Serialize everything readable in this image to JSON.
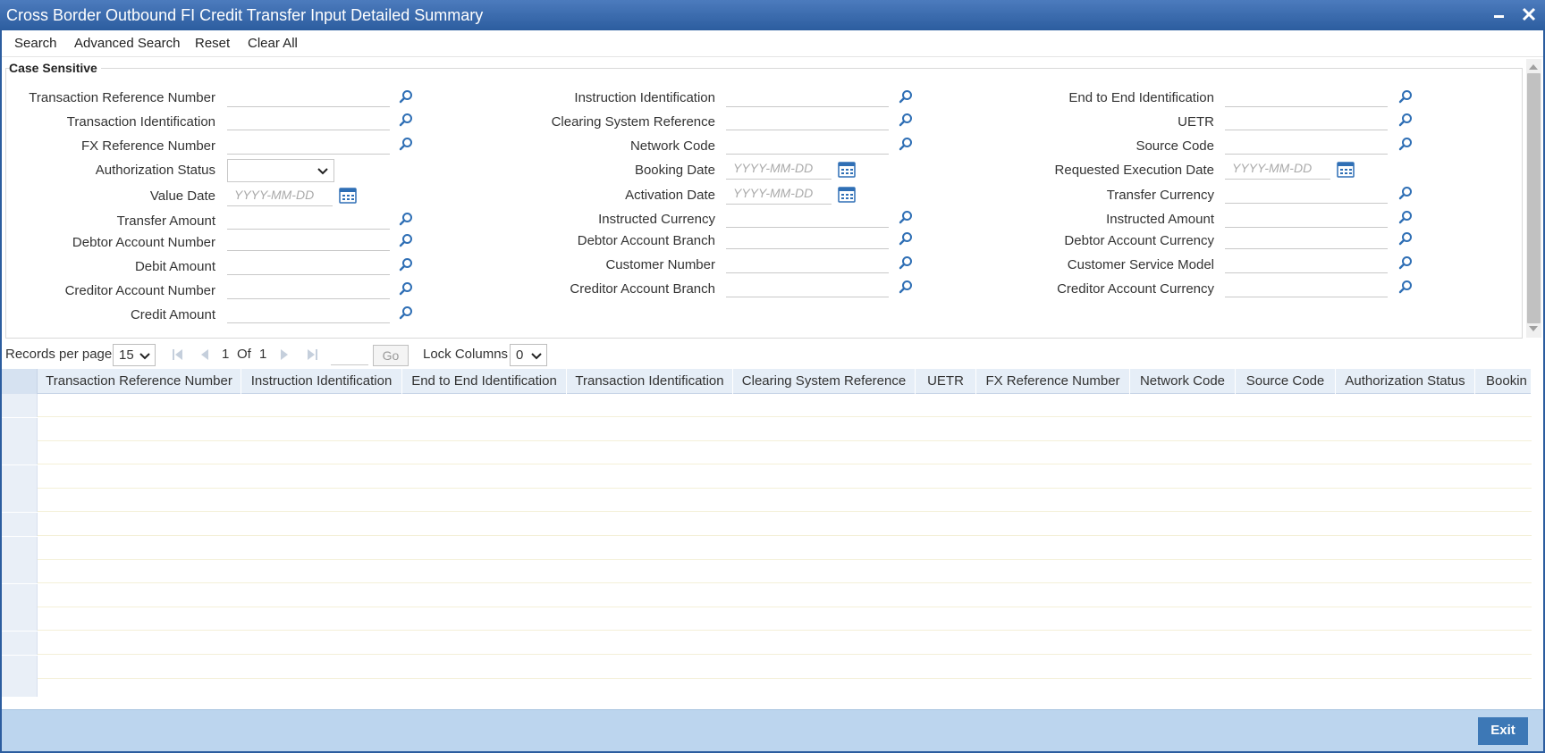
{
  "window": {
    "title": "Cross Border Outbound FI Credit Transfer Input Detailed Summary"
  },
  "toolbar": {
    "search": "Search",
    "advanced_search": "Advanced Search",
    "reset": "Reset",
    "clear_all": "Clear All"
  },
  "criteria": {
    "section_title": "Case Sensitive",
    "date_placeholder": "YYYY-MM-DD",
    "col1": {
      "transaction_reference_number": "Transaction Reference Number",
      "transaction_identification": "Transaction Identification",
      "fx_reference_number": "FX Reference Number",
      "authorization_status": "Authorization Status",
      "value_date": "Value Date",
      "transfer_amount": "Transfer Amount",
      "debtor_account_number": "Debtor Account Number",
      "debit_amount": "Debit Amount",
      "creditor_account_number": "Creditor Account Number",
      "credit_amount": "Credit Amount"
    },
    "col2": {
      "instruction_identification": "Instruction Identification",
      "clearing_system_reference": "Clearing System Reference",
      "network_code": "Network Code",
      "booking_date": "Booking Date",
      "activation_date": "Activation Date",
      "instructed_currency": "Instructed Currency",
      "debtor_account_branch": "Debtor Account Branch",
      "customer_number": "Customer Number",
      "creditor_account_branch": "Creditor Account Branch"
    },
    "col3": {
      "end_to_end_identification": "End to End Identification",
      "uetr": "UETR",
      "source_code": "Source Code",
      "requested_execution_date": "Requested Execution Date",
      "transfer_currency": "Transfer Currency",
      "instructed_amount": "Instructed Amount",
      "debtor_account_currency": "Debtor Account Currency",
      "customer_service_model": "Customer Service Model",
      "creditor_account_currency": "Creditor Account Currency"
    }
  },
  "pager": {
    "records_per_page_label": "Records per page",
    "records_per_page_value": "15",
    "current_page": "1",
    "of_label": "Of",
    "total_pages": "1",
    "go_label": "Go",
    "lock_columns_label": "Lock Columns",
    "lock_columns_value": "0"
  },
  "grid": {
    "columns": [
      "Transaction Reference Number",
      "Instruction Identification",
      "End to End Identification",
      "Transaction Identification",
      "Clearing System Reference",
      "UETR",
      "FX Reference Number",
      "Network Code",
      "Source Code",
      "Authorization Status",
      "Bookin"
    ],
    "row_count": 13
  },
  "footer": {
    "exit": "Exit"
  },
  "colors": {
    "titlebar": "#2c5d9f",
    "footer": "#bcd5ee",
    "exit_button": "#3d78b6",
    "grid_header": "#e6eef7"
  },
  "icons": {
    "search_field": "magnifier-icon",
    "date_field": "calendar-icon"
  }
}
